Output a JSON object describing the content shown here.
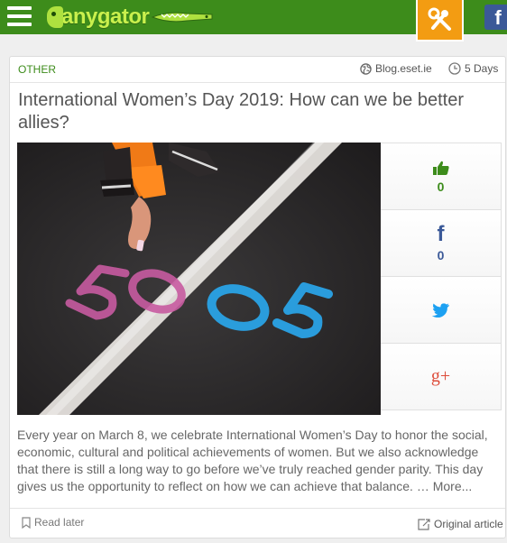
{
  "header": {
    "logo_text": "anygator",
    "icons": [
      "menu-icon",
      "tools-icon",
      "facebook-icon"
    ],
    "facebook_letter": "f"
  },
  "article": {
    "category": "OTHER",
    "source": "Blog.eset.ie",
    "age": "5 Days",
    "title": "International Women’s Day 2019: How can we be better allies?",
    "image_alt": "Hand drawing 50 50 in chalk on road",
    "excerpt": "Every year on March 8, we celebrate International Women’s Day to honor the social, economic, cultural and political achievements of women. But we also acknowledge that there is still a long way to go before we’ve truly reached gender parity. This day gives us the opportunity to reflect on how we can achieve that balance. …",
    "more_label": "More...",
    "read_later_label": "Read later",
    "original_label": "Original article"
  },
  "shares": {
    "like_count": "0",
    "facebook_count": "0",
    "icons": [
      "thumbs-up-icon",
      "facebook-icon",
      "twitter-icon",
      "google-plus-icon"
    ],
    "facebook_letter": "f",
    "google_plus_text": "g+"
  },
  "colors": {
    "brand_green": "#3d8c1b",
    "accent_orange": "#f39c12",
    "facebook_blue": "#3b5998",
    "twitter_blue": "#1da1f2",
    "google_red": "#dd4b39"
  }
}
